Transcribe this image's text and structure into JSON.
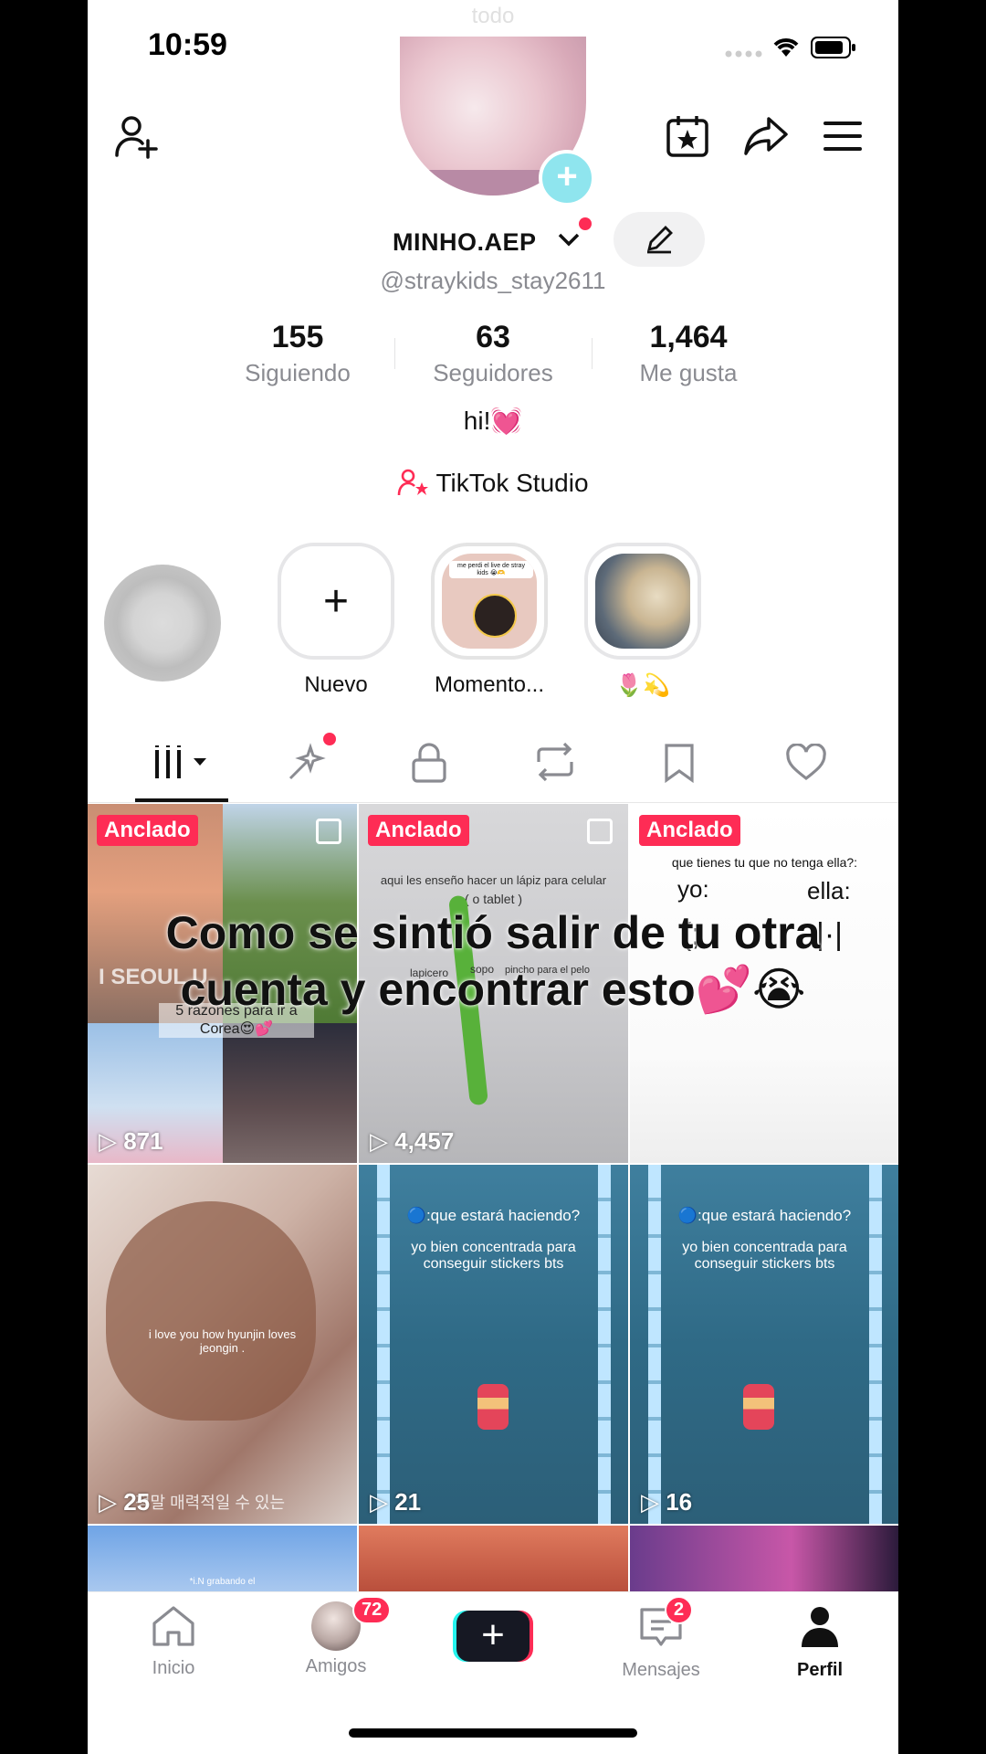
{
  "status": {
    "time": "10:59",
    "ghost_text": "todo"
  },
  "profile": {
    "username": "MINHO.AEP",
    "handle": "@straykids_stay2611",
    "stats": [
      {
        "value": "155",
        "label": "Siguiendo"
      },
      {
        "value": "63",
        "label": "Seguidores"
      },
      {
        "value": "1,464",
        "label": "Me gusta"
      }
    ],
    "bio": "hi!💓",
    "studio_label": "TikTok Studio"
  },
  "highlights": [
    {
      "label": ""
    },
    {
      "label": "Nuevo"
    },
    {
      "label": "Momento...",
      "thumb_caption": "me perdi el live de stray kids 😭🫶"
    },
    {
      "label": "🌷💫"
    }
  ],
  "tabs": [
    "videos",
    "reposts-sparkle",
    "private",
    "reposts",
    "favorites",
    "liked"
  ],
  "videos": [
    {
      "pinned": "Anclado",
      "views": "871",
      "caption": "5 razones para ir a Corea😍💕",
      "sign": "I SEOUL U"
    },
    {
      "pinned": "Anclado",
      "views": "4,457",
      "caption": "aqui les enseño hacer un lápiz para celular",
      "caption2": "( o tablet )",
      "words": [
        "lapicero",
        "sopo",
        "pincho para el pelo"
      ]
    },
    {
      "pinned": "Anclado",
      "views": "",
      "caption": "que tienes tu que no tenga ella?:",
      "yo": "yo:",
      "ella": "ella:",
      "yo_face": "(;",
      "ella_face": "|·|"
    },
    {
      "pinned": "",
      "views": "25",
      "caption": "i love you how hyunjin loves jeongin .",
      "korean": "정말 매력적일 수 있는"
    },
    {
      "pinned": "",
      "views": "21",
      "caption": "🔵:que estará haciendo?",
      "caption2": "yo bien concentrada para conseguir stickers bts"
    },
    {
      "pinned": "",
      "views": "16",
      "caption": "🔵:que estará haciendo?",
      "caption2": "yo bien concentrada para conseguir stickers bts"
    },
    {
      "pinned": "",
      "views": "",
      "caption": "*i.N grabando el"
    },
    {
      "pinned": "",
      "views": ""
    },
    {
      "pinned": "",
      "views": ""
    }
  ],
  "overlay_text": {
    "line1": "Como se sintió salir de tu otra",
    "line2": "cuenta y encontrar esto💕😭"
  },
  "nav": {
    "home": "Inicio",
    "friends": "Amigos",
    "friends_badge": "72",
    "messages": "Mensajes",
    "messages_badge": "2",
    "profile": "Perfil"
  },
  "colors": {
    "accent": "#fe2c55",
    "cyan": "#25f4ee",
    "grey_text": "#8a8b91"
  }
}
